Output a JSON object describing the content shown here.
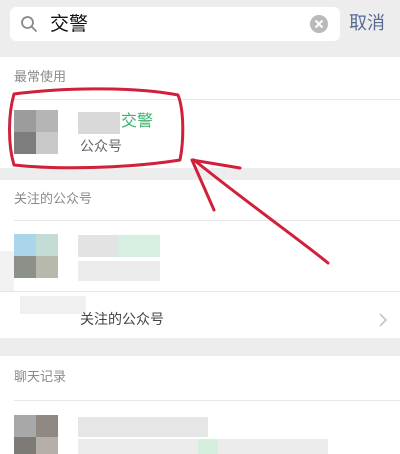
{
  "search": {
    "query": "交警",
    "cancel_label": "取消"
  },
  "frequent": {
    "header": "最常使用",
    "item": {
      "name_visible": "交警",
      "subtitle": "公众号"
    }
  },
  "followed": {
    "header": "关注的公众号",
    "more_link_visible": "关注的公众号"
  },
  "chat": {
    "header": "聊天记录"
  },
  "colors": {
    "highlight_green": "#3ab26a",
    "link_blue": "#576b95",
    "annotation_red": "#d0203a"
  }
}
